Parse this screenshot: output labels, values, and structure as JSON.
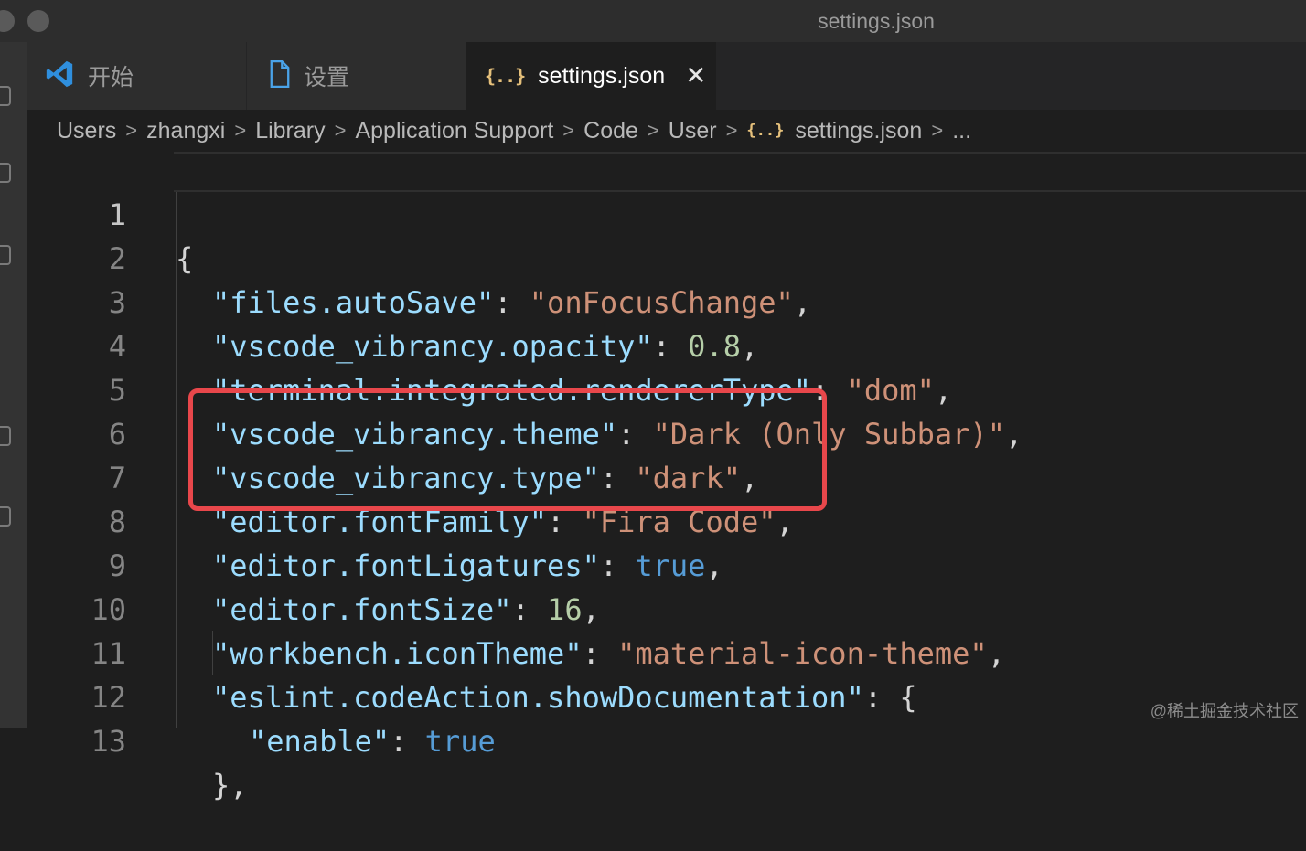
{
  "window": {
    "title": "settings.json"
  },
  "tabs": [
    {
      "label": "开始",
      "icon": "vscode-logo-icon",
      "active": false
    },
    {
      "label": "设置",
      "icon": "file-icon",
      "active": false
    },
    {
      "label": "settings.json",
      "icon": "json-braces-icon",
      "icon_text": "{..}",
      "active": true
    }
  ],
  "breadcrumb": {
    "items": [
      "Users",
      "zhangxi",
      "Library",
      "Application Support",
      "Code",
      "User",
      "settings.json"
    ],
    "json_icon_text": "{..}",
    "ellipsis": "..."
  },
  "editor": {
    "line_numbers": [
      "1",
      "2",
      "3",
      "4",
      "5",
      "6",
      "7",
      "8",
      "9",
      "10",
      "11",
      "12",
      "13"
    ],
    "lines": {
      "l1": {
        "open": "{"
      },
      "l2": {
        "key": "\"files.autoSave\"",
        "value": "\"onFocusChange\""
      },
      "l3": {
        "key": "\"vscode_vibrancy.opacity\"",
        "value": "0.8"
      },
      "l4": {
        "key": "\"terminal.integrated.rendererType\"",
        "value": "\"dom\""
      },
      "l5": {
        "key": "\"vscode_vibrancy.theme\"",
        "value": "\"Dark (Only Subbar)\""
      },
      "l6": {
        "key": "\"vscode_vibrancy.type\"",
        "value": "\"dark\""
      },
      "l7": {
        "key": "\"editor.fontFamily\"",
        "value": "\"Fira Code\""
      },
      "l8": {
        "key": "\"editor.fontLigatures\"",
        "value": "true"
      },
      "l9": {
        "key": "\"editor.fontSize\"",
        "value": "16"
      },
      "l10": {
        "key": "\"workbench.iconTheme\"",
        "value": "\"material-icon-theme\""
      },
      "l11": {
        "key": "\"eslint.codeAction.showDocumentation\"",
        "value": "{"
      },
      "l12": {
        "key": "\"enable\"",
        "value": "true"
      },
      "l13": {
        "close": "},"
      }
    },
    "punct": {
      "colon": ": ",
      "comma": ","
    }
  },
  "colors": {
    "json_key": "#9cdcfe",
    "json_string": "#ce9178",
    "json_number": "#b5cea8",
    "json_boolean": "#569cd6",
    "highlight_box": "#e8474b"
  },
  "watermark": "@稀土掘金技术社区"
}
